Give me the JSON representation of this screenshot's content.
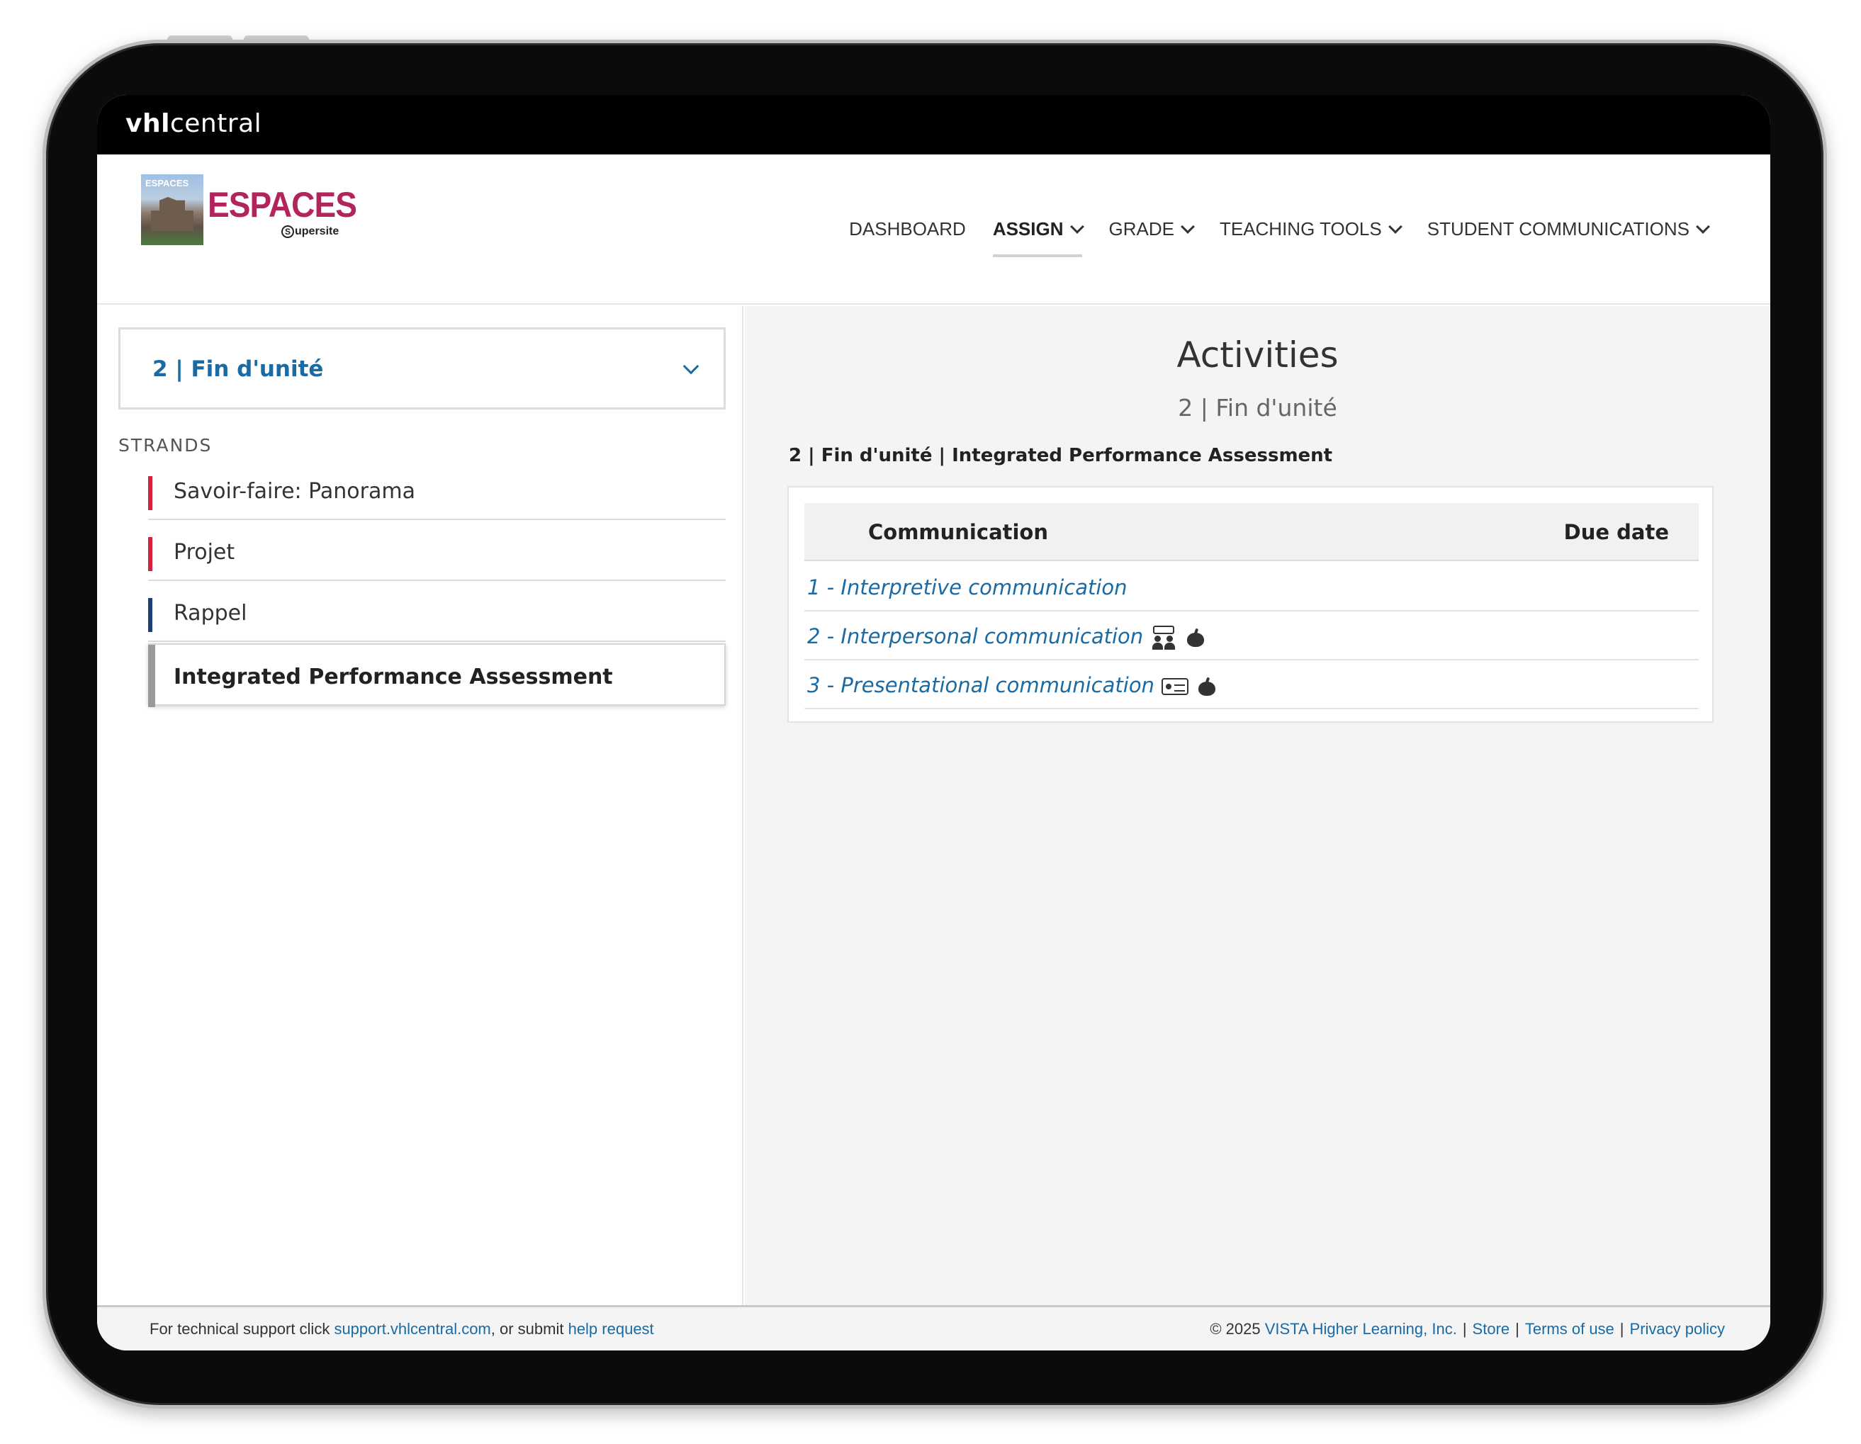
{
  "topbar": {
    "brand_bold": "vhl",
    "brand_rest": "central"
  },
  "logo": {
    "title": "ESPACES",
    "cover_label": "ESPACES",
    "sub_mark": "S",
    "sub_text": "upersite"
  },
  "nav": {
    "items": [
      {
        "label": "DASHBOARD",
        "active": false
      },
      {
        "label": "ASSIGN",
        "active": true
      },
      {
        "label": "GRADE",
        "active": false
      },
      {
        "label": "TEACHING TOOLS",
        "active": false
      },
      {
        "label": "STUDENT COMMUNICATIONS",
        "active": false
      }
    ]
  },
  "sidebar": {
    "unit_selected": "2 | Fin d'unité",
    "strands_title": "STRANDS",
    "strands": [
      {
        "label": "Savoir-faire: Panorama",
        "color": "#d3223a"
      },
      {
        "label": "Projet",
        "color": "#d3223a"
      },
      {
        "label": "Rappel",
        "color": "#1f3f7a"
      },
      {
        "label": "Integrated Performance Assessment",
        "color": "#9a9a9a",
        "selected": true
      }
    ]
  },
  "main": {
    "title": "Activities",
    "subtitle": "2 | Fin d'unité",
    "breadcrumb": "2 | Fin d'unité | Integrated Performance Assessment",
    "table": {
      "col_communication": "Communication",
      "col_due": "Due date",
      "rows": [
        {
          "label": "1 - Interpretive communication",
          "icons": []
        },
        {
          "label": "2 - Interpersonal communication",
          "icons": [
            "people-chat-icon",
            "apple-icon"
          ]
        },
        {
          "label": "3 - Presentational communication",
          "icons": [
            "presentation-icon",
            "apple-icon"
          ]
        }
      ]
    }
  },
  "footer": {
    "left_prefix": "For technical support click ",
    "support_link": "support.vhlcentral.com",
    "left_middle": ", or submit ",
    "help_link": "help request",
    "copyright": "© 2025 ",
    "company_link": "VISTA Higher Learning, Inc.",
    "store_link": "Store",
    "terms_link": "Terms of use",
    "privacy_link": "Privacy policy",
    "separator": "|"
  },
  "colors": {
    "accent_blue": "#1a6aa3",
    "logo_magenta": "#b2245c"
  }
}
